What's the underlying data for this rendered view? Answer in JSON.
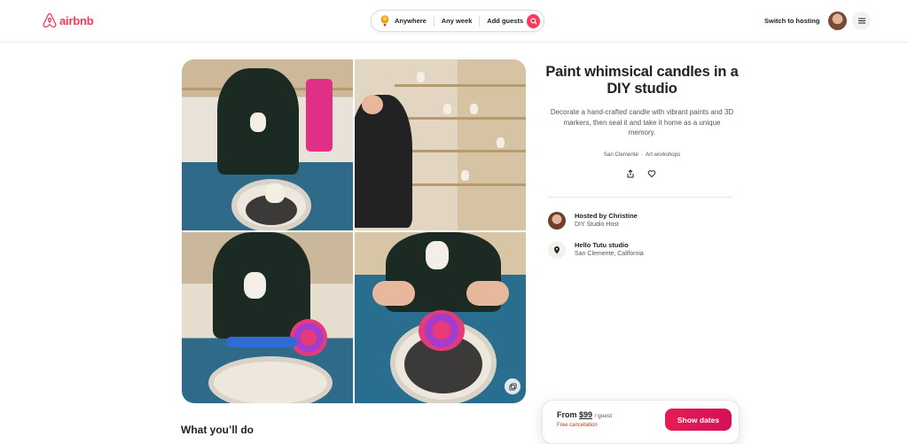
{
  "header": {
    "logo_text": "airbnb",
    "search": {
      "anywhere": "Anywhere",
      "anyweek": "Any week",
      "guests": "Add guests"
    },
    "switch_hosting": "Switch to hosting"
  },
  "listing": {
    "title": "Paint whimsical candles in a DIY studio",
    "description": "Decorate a hand-crafted candle with vibrant paints and 3D markers, then seal it and take it home as a unique memory.",
    "location": "San Clemente",
    "category": "Art workshops",
    "meta_separator": "·"
  },
  "host": {
    "name": "Hosted by Christine",
    "role": "DIY Studio Host"
  },
  "place": {
    "name": "Hello Tutu studio",
    "location": "San Clemente, California"
  },
  "section": {
    "what_youll_do": "What you’ll do"
  },
  "booking": {
    "from_label": "From",
    "price": "$99",
    "per": "/ guest",
    "cancellation": "Free cancellation",
    "button": "Show dates"
  },
  "colors": {
    "brand": "#ff385c",
    "cta": "#e51d53",
    "cancel_text": "#c13515"
  },
  "icons": [
    "airbnb-logo-icon",
    "balloon-icon",
    "search-icon",
    "menu-icon",
    "share-icon",
    "heart-icon",
    "location-pin-icon",
    "gallery-grid-icon"
  ]
}
